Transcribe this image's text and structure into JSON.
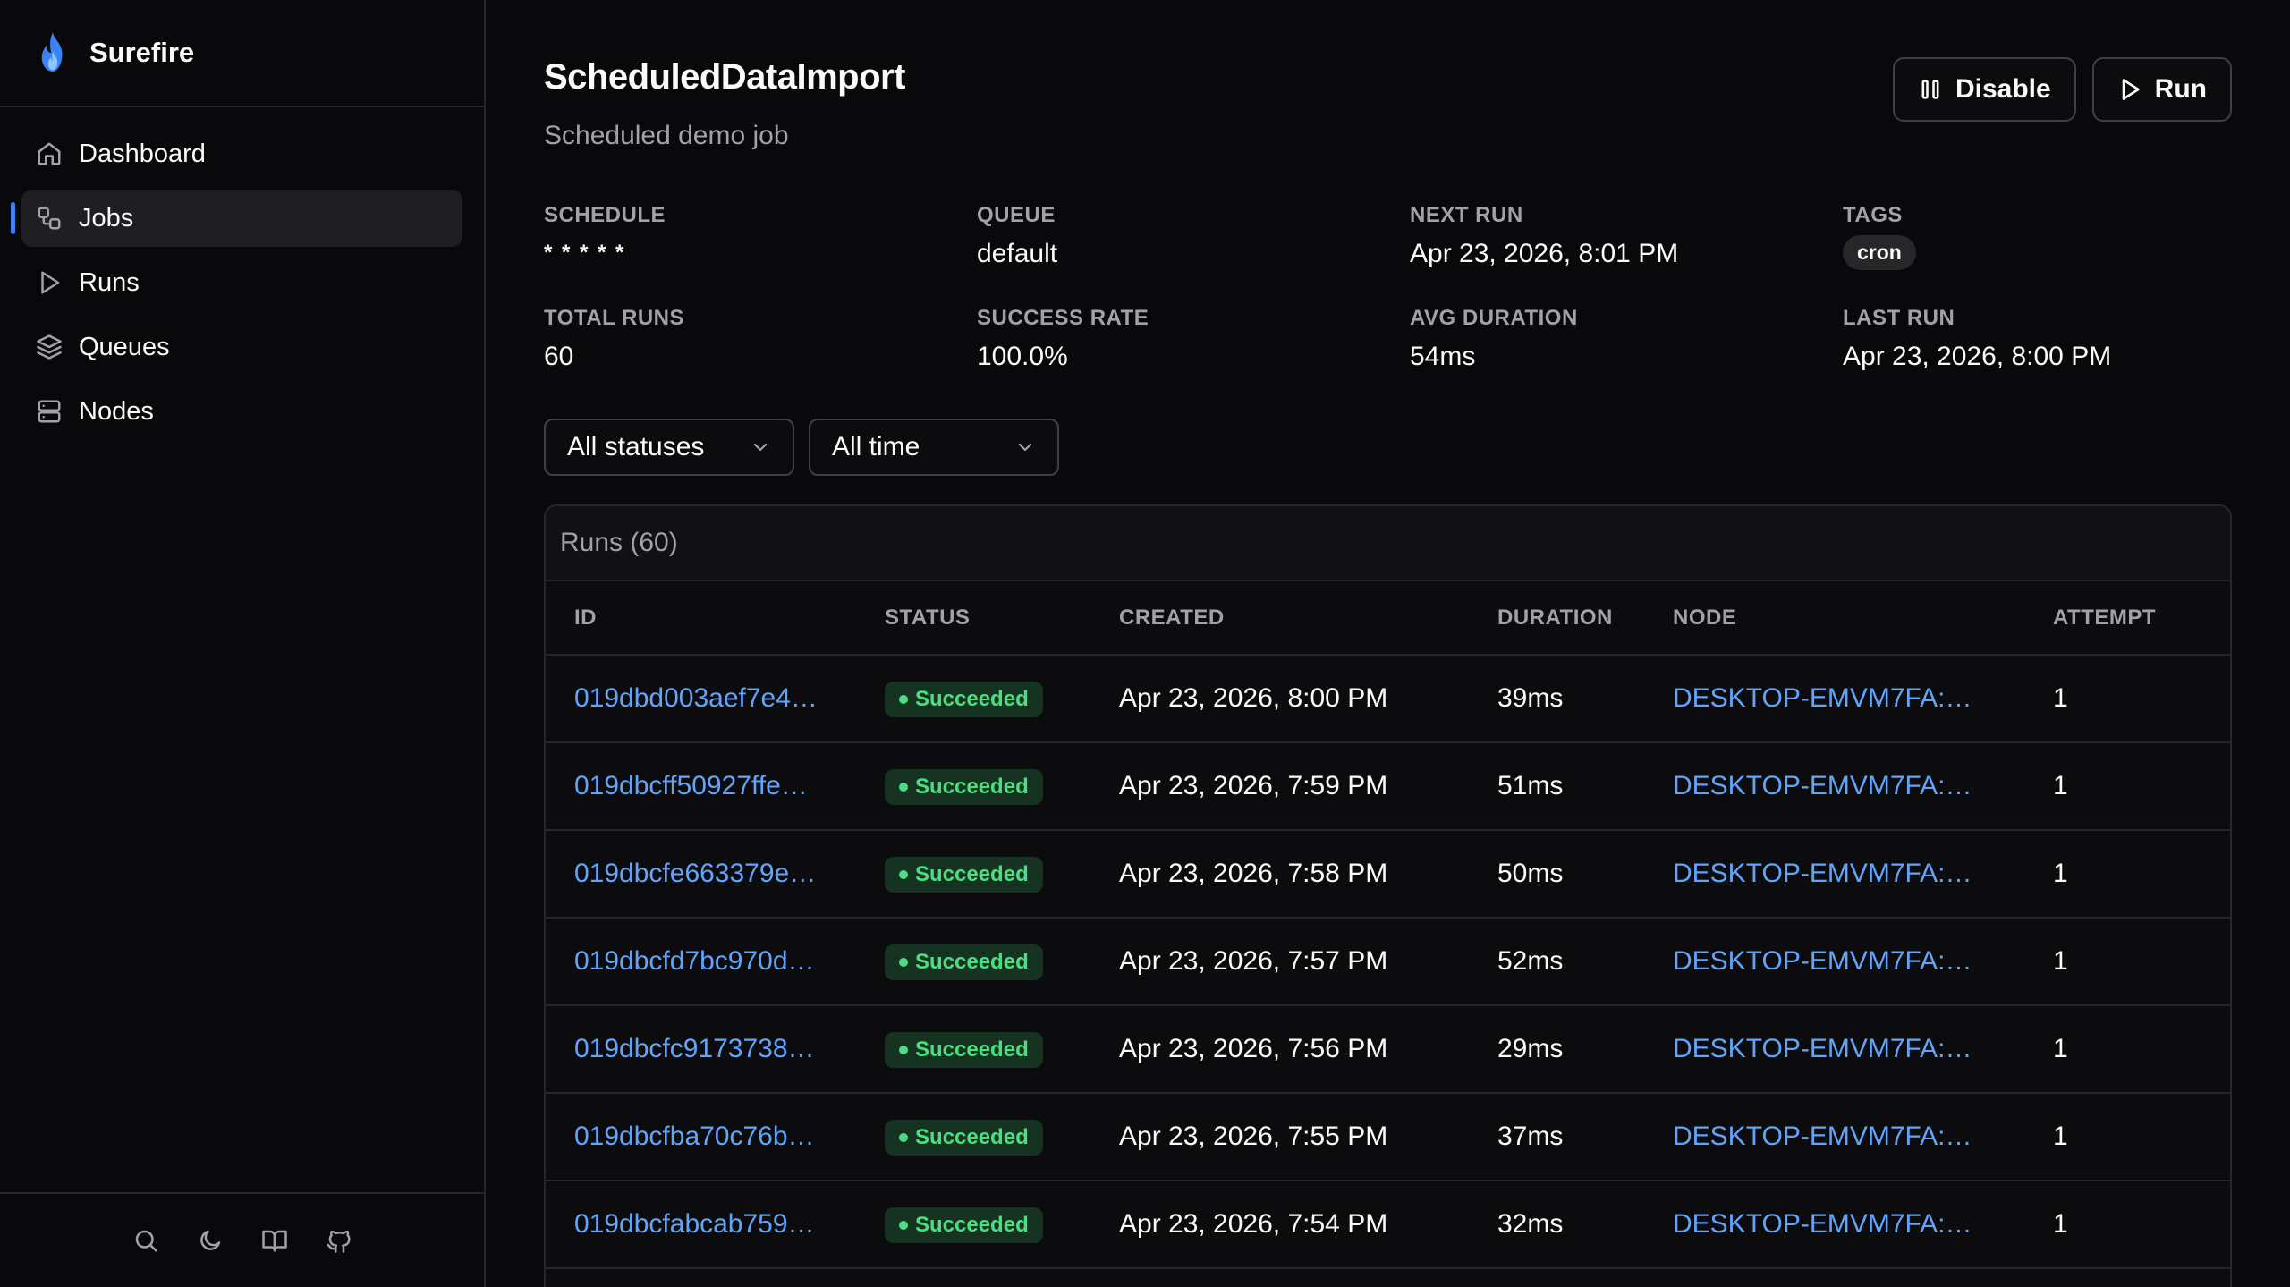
{
  "brand": {
    "name": "Surefire",
    "accent": "#3b82f6"
  },
  "sidebar": {
    "items": [
      {
        "label": "Dashboard",
        "icon": "home-icon"
      },
      {
        "label": "Jobs",
        "icon": "workflow-icon",
        "active": true
      },
      {
        "label": "Runs",
        "icon": "play-icon"
      },
      {
        "label": "Queues",
        "icon": "layers-icon"
      },
      {
        "label": "Nodes",
        "icon": "server-icon"
      }
    ],
    "footer_icons": [
      "search-icon",
      "moon-icon",
      "book-icon",
      "github-icon"
    ]
  },
  "job": {
    "title": "ScheduledDataImport",
    "description": "Scheduled demo job",
    "disable_label": "Disable",
    "run_label": "Run"
  },
  "stats": {
    "schedule_label": "SCHEDULE",
    "schedule_value": "* * * * *",
    "queue_label": "QUEUE",
    "queue_value": "default",
    "next_run_label": "NEXT RUN",
    "next_run_value": "Apr 23, 2026, 8:01 PM",
    "tags_label": "TAGS",
    "tag_value": "cron",
    "total_runs_label": "TOTAL RUNS",
    "total_runs_value": "60",
    "success_rate_label": "SUCCESS RATE",
    "success_rate_value": "100.0%",
    "avg_duration_label": "AVG DURATION",
    "avg_duration_value": "54ms",
    "last_run_label": "LAST RUN",
    "last_run_value": "Apr 23, 2026, 8:00 PM"
  },
  "filters": {
    "status_selected": "All statuses",
    "time_selected": "All time"
  },
  "runs": {
    "header": "Runs (60)",
    "columns": [
      "ID",
      "STATUS",
      "CREATED",
      "DURATION",
      "NODE",
      "ATTEMPT"
    ],
    "rows": [
      {
        "id": "019dbd003aef7e4…",
        "status": "Succeeded",
        "created": "Apr 23, 2026, 8:00 PM",
        "duration": "39ms",
        "node": "DESKTOP-EMVM7FA:…",
        "attempt": "1"
      },
      {
        "id": "019dbcff50927ffe…",
        "status": "Succeeded",
        "created": "Apr 23, 2026, 7:59 PM",
        "duration": "51ms",
        "node": "DESKTOP-EMVM7FA:…",
        "attempt": "1"
      },
      {
        "id": "019dbcfe663379e…",
        "status": "Succeeded",
        "created": "Apr 23, 2026, 7:58 PM",
        "duration": "50ms",
        "node": "DESKTOP-EMVM7FA:…",
        "attempt": "1"
      },
      {
        "id": "019dbcfd7bc970d…",
        "status": "Succeeded",
        "created": "Apr 23, 2026, 7:57 PM",
        "duration": "52ms",
        "node": "DESKTOP-EMVM7FA:…",
        "attempt": "1"
      },
      {
        "id": "019dbcfc9173738…",
        "status": "Succeeded",
        "created": "Apr 23, 2026, 7:56 PM",
        "duration": "29ms",
        "node": "DESKTOP-EMVM7FA:…",
        "attempt": "1"
      },
      {
        "id": "019dbcfba70c76b…",
        "status": "Succeeded",
        "created": "Apr 23, 2026, 7:55 PM",
        "duration": "37ms",
        "node": "DESKTOP-EMVM7FA:…",
        "attempt": "1"
      },
      {
        "id": "019dbcfabcab759…",
        "status": "Succeeded",
        "created": "Apr 23, 2026, 7:54 PM",
        "duration": "32ms",
        "node": "DESKTOP-EMVM7FA:…",
        "attempt": "1"
      }
    ]
  },
  "colors": {
    "success": "#4ade80",
    "link": "#60a5fa",
    "background": "#09090b",
    "border": "#27272a"
  }
}
